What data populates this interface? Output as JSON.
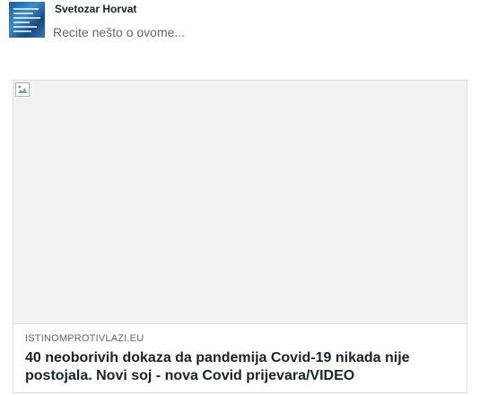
{
  "composer": {
    "author_name": "Svetozar Horvat",
    "placeholder": "Recite nešto o ovome..."
  },
  "link_preview": {
    "image_icon": "broken-image-icon",
    "domain": "ISTINOMPROTIVLAZI.EU",
    "title": "40 neoborivih dokaza da pandemija Covid-19 nikada nije postojala. Novi soj - nova Covid prijevara/VIDEO"
  }
}
